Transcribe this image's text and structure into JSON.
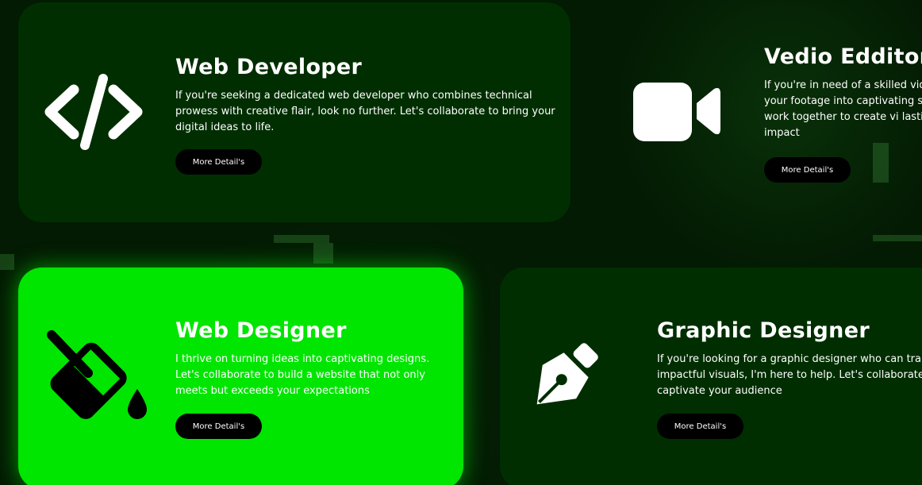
{
  "cards": [
    {
      "title": "Web Developer",
      "description": "If you're seeking a dedicated web developer who combines technical prowess with creative flair, look no further. Let's collaborate to bring your digital ideas to life.",
      "button_label": "More Detail's",
      "icon": "code-icon"
    },
    {
      "title": "Vedio Edditor",
      "description": "If you're in need of a skilled vid your footage into captivating s Let's work together to create vi lasting impact",
      "button_label": "More Detail's",
      "icon": "video-camera-icon"
    },
    {
      "title": "Web Designer",
      "description": "I thrive on turning ideas into captivating designs. Let's collaborate to build a website that not only meets but exceeds your expectations",
      "button_label": "More Detail's",
      "icon": "paint-bucket-icon"
    },
    {
      "title": "Graphic Designer",
      "description": "If you're looking for a graphic designer who can tran impactful visuals, I'm here to help. Let's collaborate and captivate your audience",
      "button_label": "More Detail's",
      "icon": "pen-nib-icon"
    }
  ],
  "colors": {
    "background": "#031a03",
    "card": "#002e00",
    "card_active": "#00e600",
    "button": "#000000",
    "text": "#ffffff"
  }
}
